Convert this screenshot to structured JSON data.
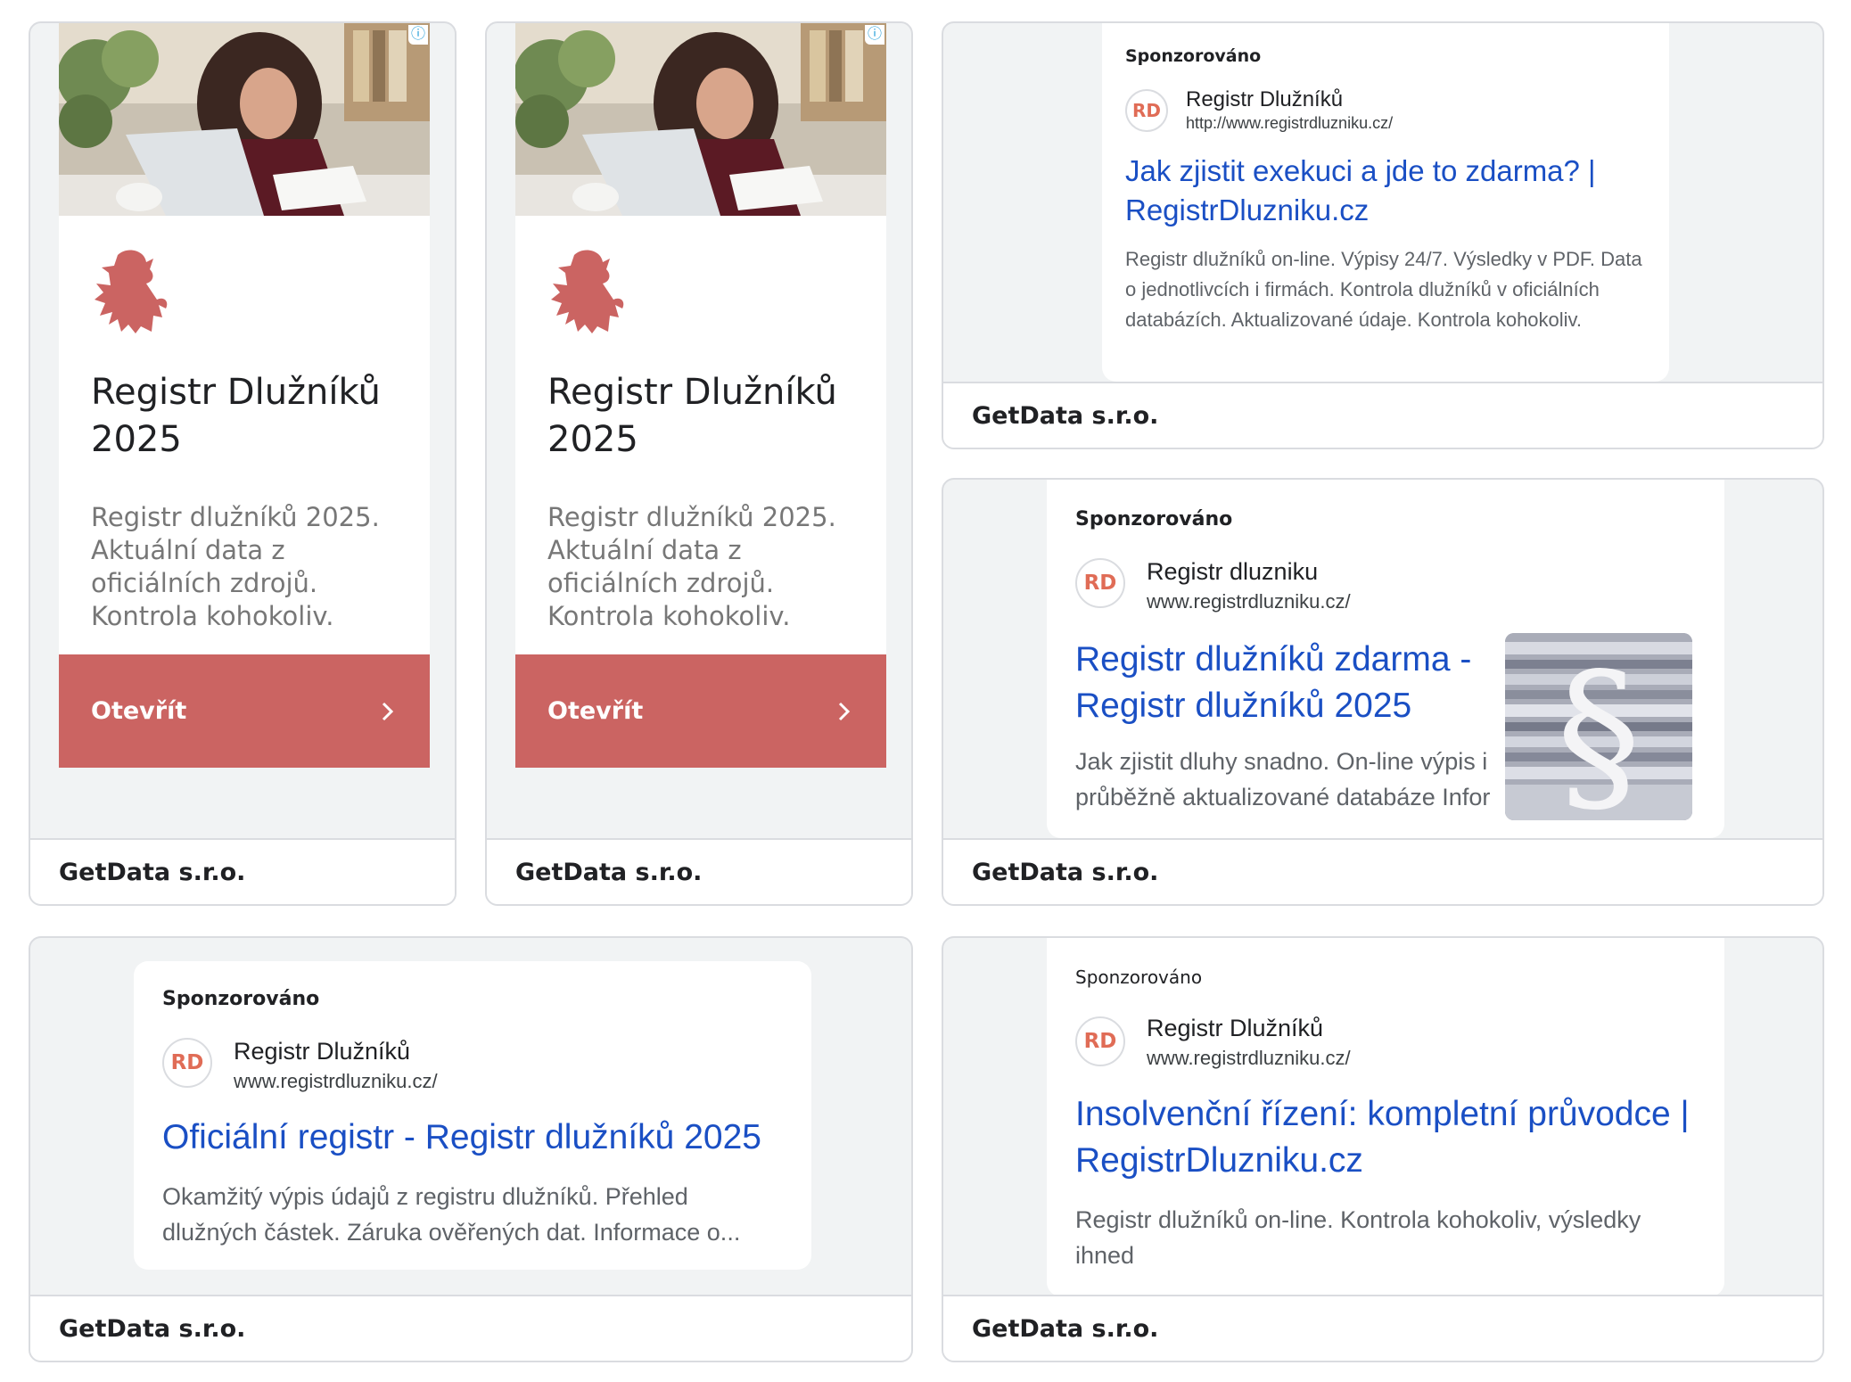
{
  "advertiser": "GetData s.r.o.",
  "display_ad": {
    "title": "Registr Dlužníků 2025",
    "description": "Registr dlužníků 2025. Aktuální data z oficiálních zdrojů. Kontrola kohokoliv.",
    "cta_label": "Otevřít",
    "info_icon": "info-icon",
    "brand_color": "#cb6462"
  },
  "sponsored_label": "Sponzorováno",
  "logo_text": "RD",
  "ads": [
    {
      "name": "Registr Dlužníků",
      "url": "http://www.registrdluzniku.cz/",
      "headline": "Jak zjistit exekuci a jde to zdarma? | RegistrDluzniku.cz",
      "body": "Registr dlužníků on-line. Výpisy 24/7. Výsledky v PDF. Data o jednotlivcích i firmách. Kontrola dlužníků v oficiálních databázích. Aktualizované údaje. Kontrola kohokoliv."
    },
    {
      "name": "Registr dluzniku",
      "url": "www.registrdluzniku.cz/",
      "headline": "Registr dlužníků zdarma - Registr dlužníků 2025",
      "body": "Jak zjistit dluhy snadno. On-line výpis i průběžně aktualizované databáze Infor"
    },
    {
      "name": "Registr Dlužníků",
      "url": "www.registrdluzniku.cz/",
      "headline": "Oficiální registr - Registr dlužníků 2025",
      "body": "Okamžitý výpis údajů z registru dlužníků. Přehled dlužných částek. Záruka ověřených dat. Informace o..."
    },
    {
      "name": "Registr Dlužníků",
      "url": "www.registrdluzniku.cz/",
      "headline": "Insolvenční řízení: kompletní průvodce | RegistrDluzniku.cz",
      "body": "Registr dlužníků on-line. Kontrola kohokoliv, výsledky ihned"
    }
  ]
}
